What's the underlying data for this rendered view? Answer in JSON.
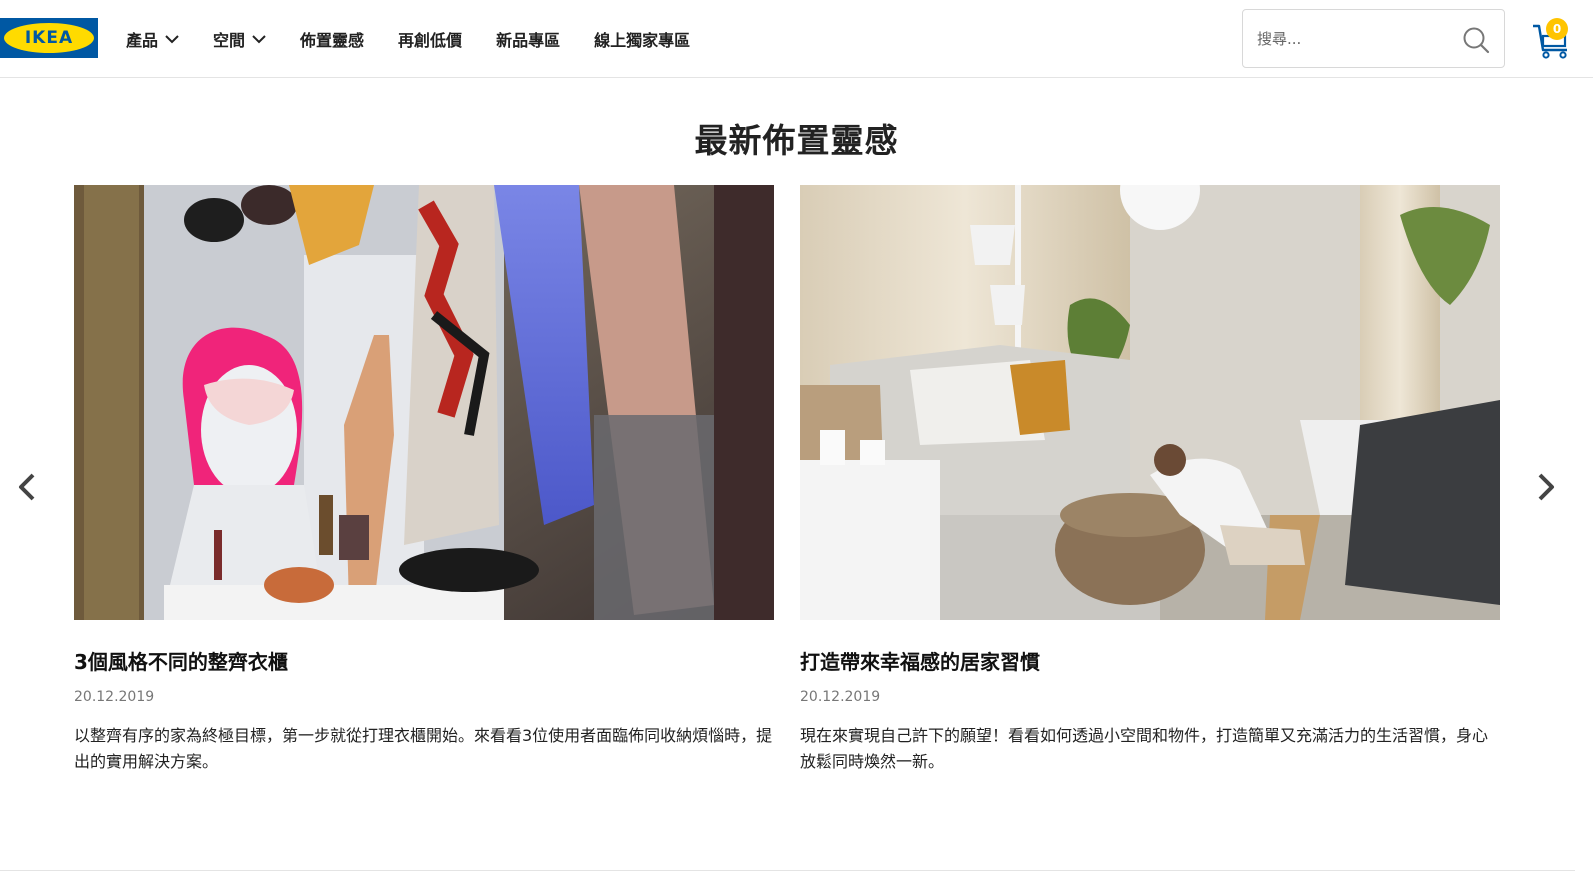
{
  "brand": {
    "logo_text": "IKEA",
    "primary": "#0058a3",
    "accent": "#ffdb00"
  },
  "nav": {
    "items": [
      {
        "label": "產品",
        "has_dropdown": true
      },
      {
        "label": "空間",
        "has_dropdown": true
      },
      {
        "label": "佈置靈感",
        "has_dropdown": false
      },
      {
        "label": "再創低價",
        "has_dropdown": false
      },
      {
        "label": "新品專區",
        "has_dropdown": false
      },
      {
        "label": "線上獨家專區",
        "has_dropdown": false
      }
    ]
  },
  "search": {
    "placeholder": "搜尋...",
    "value": ""
  },
  "cart": {
    "count": "0",
    "badge_color": "#ffc400"
  },
  "main": {
    "title": "最新佈置靈感",
    "cards": [
      {
        "title": "3個風格不同的整齊衣櫃",
        "date": "20.12.2019",
        "description": "以整齊有序的家為終極目標，第一步就從打理衣櫃開始。來看看3位使用者面臨佈同收納煩惱時，提出的實用解決方案。"
      },
      {
        "title": "打造帶來幸福感的居家習慣",
        "date": "20.12.2019",
        "description": "現在來實現自己許下的願望！看看如何透過小空間和物件，打造簡單又充滿活力的生活習慣，身心放鬆同時煥然一新。"
      }
    ]
  },
  "icons": {
    "prev": "chevron-left-icon",
    "next": "chevron-right-icon",
    "search": "search-icon",
    "cart": "cart-icon"
  }
}
